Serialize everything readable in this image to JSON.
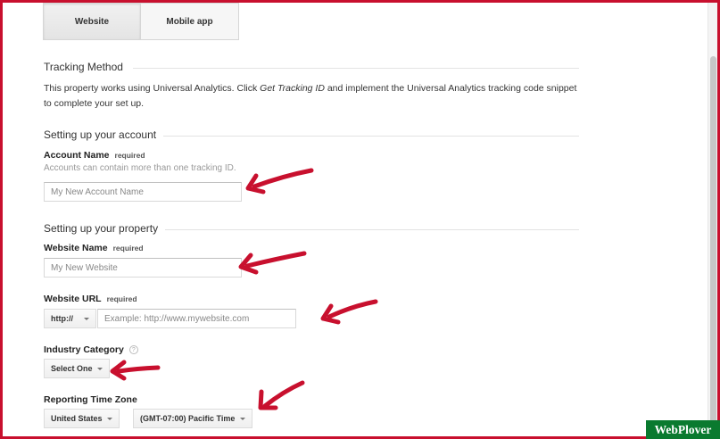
{
  "tabs": [
    {
      "label": "Website",
      "active": true
    },
    {
      "label": "Mobile app",
      "active": false
    }
  ],
  "tracking_method": {
    "title": "Tracking Method",
    "text_before": "This property works using Universal Analytics. Click ",
    "link_text": "Get Tracking ID",
    "text_after": " and implement the Universal Analytics tracking code snippet to complete your set up."
  },
  "account_section": {
    "title": "Setting up your account",
    "account_name": {
      "label": "Account Name",
      "required": "required",
      "hint": "Accounts can contain more than one tracking ID.",
      "placeholder": "My New Account Name",
      "value": ""
    }
  },
  "property_section": {
    "title": "Setting up your property",
    "website_name": {
      "label": "Website Name",
      "required": "required",
      "placeholder": "My New Website",
      "value": ""
    },
    "website_url": {
      "label": "Website URL",
      "required": "required",
      "protocol": "http://",
      "placeholder": "Example: http://www.mywebsite.com",
      "value": ""
    },
    "industry_category": {
      "label": "Industry Category",
      "help": "?",
      "selected": "Select One"
    },
    "time_zone": {
      "label": "Reporting Time Zone",
      "country": "United States",
      "zone": "(GMT-07:00) Pacific Time"
    }
  },
  "watermark": "WebPlover",
  "colors": {
    "frame": "#c8102e",
    "arrow": "#c8102e",
    "watermark_bg": "#0a7a2f"
  }
}
